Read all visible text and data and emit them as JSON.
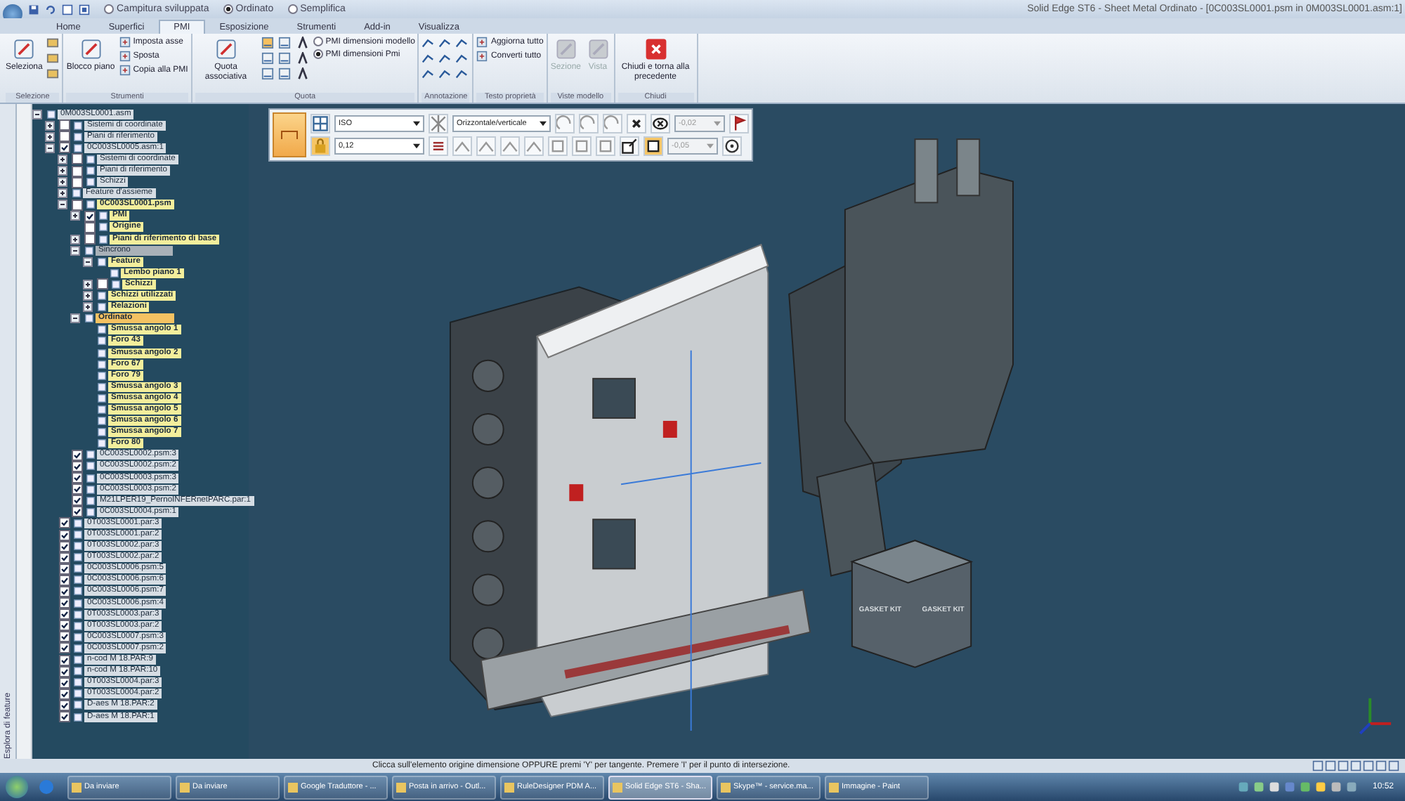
{
  "window": {
    "title": "Solid Edge ST6 - Sheet Metal Ordinato - [0C003SL0001.psm in 0M003SL0001.asm:1]"
  },
  "quick_access": [
    {
      "label": "Campitura sviluppata",
      "selected": false
    },
    {
      "label": "Ordinato",
      "selected": true
    },
    {
      "label": "Semplifica",
      "selected": false
    }
  ],
  "tabs": [
    {
      "label": "Home",
      "selected": false
    },
    {
      "label": "Superfici",
      "selected": false
    },
    {
      "label": "PMI",
      "selected": true
    },
    {
      "label": "Esposizione",
      "selected": false
    },
    {
      "label": "Strumenti",
      "selected": false
    },
    {
      "label": "Add-in",
      "selected": false
    },
    {
      "label": "Visualizza",
      "selected": false
    }
  ],
  "ribbon": [
    {
      "label": "Selezione",
      "items": [
        {
          "kind": "large",
          "label": "Seleziona",
          "disabled": false
        }
      ]
    },
    {
      "label": "Strumenti",
      "items": [
        {
          "kind": "large",
          "label": "Blocco piano",
          "disabled": false
        },
        {
          "kind": "small",
          "label": "Imposta asse",
          "disabled": false
        },
        {
          "kind": "small",
          "label": "Sposta",
          "disabled": false
        },
        {
          "kind": "small",
          "label": "Copia alla PMI",
          "disabled": false
        }
      ]
    },
    {
      "label": "Quota",
      "items": [
        {
          "kind": "large",
          "label": "Quota associativa",
          "disabled": false
        },
        {
          "kind": "radio",
          "label": "PMI dimensioni modello",
          "selected": false
        },
        {
          "kind": "radio",
          "label": "PMI dimensioni Pmi",
          "selected": true
        }
      ]
    },
    {
      "label": "Annotazione"
    },
    {
      "label": "Testo proprietà",
      "items": [
        {
          "kind": "small",
          "label": "Aggiorna tutto",
          "disabled": false
        },
        {
          "kind": "small",
          "label": "Converti tutto",
          "disabled": false
        }
      ]
    },
    {
      "label": "Viste modello",
      "items": [
        {
          "kind": "large",
          "label": "Sezione",
          "disabled": true
        },
        {
          "kind": "large",
          "label": "Vista",
          "disabled": true
        }
      ]
    },
    {
      "label": "Chiudi",
      "items": [
        {
          "kind": "close",
          "label": "Chiudi e torna alla precedente",
          "disabled": false
        }
      ]
    }
  ],
  "side_tab": {
    "label": "Esplora di feature"
  },
  "tree": [
    {
      "label": "0M003SL0001.asm",
      "selected": false,
      "active": false,
      "expanded": true,
      "children": [
        {
          "label": "Sistemi di coordinate",
          "selected": false,
          "active": false,
          "expanded": false,
          "checked": false
        },
        {
          "label": "Piani di riferimento",
          "selected": false,
          "active": false,
          "expanded": false,
          "checked": false
        },
        {
          "label": "0C003SL0005.asm:1",
          "selected": false,
          "active": false,
          "expanded": true,
          "checked": true,
          "children": [
            {
              "label": "Sistemi di coordinate",
              "selected": false,
              "active": false,
              "expanded": false,
              "checked": false
            },
            {
              "label": "Piani di riferimento",
              "selected": false,
              "active": false,
              "expanded": false,
              "checked": false
            },
            {
              "label": "Schizzi",
              "selected": false,
              "active": false,
              "expanded": false,
              "checked": false
            },
            {
              "label": "Feature d'assieme",
              "selected": false,
              "active": false,
              "expanded": false
            },
            {
              "label": "0C003SL0001.psm",
              "selected": false,
              "active": true,
              "expanded": true,
              "checked": false,
              "children": [
                {
                  "label": "PMI",
                  "selected": false,
                  "active": true,
                  "expanded": false,
                  "checked": true
                },
                {
                  "label": "Origine",
                  "selected": false,
                  "active": true,
                  "checked": false
                },
                {
                  "label": "Piani di riferimento di base",
                  "selected": false,
                  "active": true,
                  "expanded": false,
                  "checked": false
                },
                {
                  "label": "Sincrono",
                  "selected": true,
                  "active": false,
                  "expanded": true,
                  "children": [
                    {
                      "label": "Feature",
                      "selected": false,
                      "active": true,
                      "expanded": true,
                      "children": [
                        {
                          "label": "Lembo piano 1",
                          "selected": false,
                          "active": true
                        }
                      ]
                    },
                    {
                      "label": "Schizzi",
                      "selected": false,
                      "active": true,
                      "expanded": false,
                      "checked": false
                    },
                    {
                      "label": "Schizzi utilizzati",
                      "selected": false,
                      "active": true,
                      "expanded": false
                    },
                    {
                      "label": "Relazioni",
                      "selected": false,
                      "active": true,
                      "expanded": false
                    }
                  ]
                },
                {
                  "label": "Ordinato",
                  "selected": true,
                  "active": true,
                  "expanded": true,
                  "children": [
                    {
                      "label": "Smussa angolo 1",
                      "selected": false,
                      "active": true
                    },
                    {
                      "label": "Foro 43",
                      "selected": false,
                      "active": true
                    },
                    {
                      "label": "Smussa angolo 2",
                      "selected": false,
                      "active": true
                    },
                    {
                      "label": "Foro 67",
                      "selected": false,
                      "active": true
                    },
                    {
                      "label": "Foro 79",
                      "selected": false,
                      "active": true
                    },
                    {
                      "label": "Smussa angolo 3",
                      "selected": false,
                      "active": true
                    },
                    {
                      "label": "Smussa angolo 4",
                      "selected": false,
                      "active": true
                    },
                    {
                      "label": "Smussa angolo 5",
                      "selected": false,
                      "active": true
                    },
                    {
                      "label": "Smussa angolo 6",
                      "selected": false,
                      "active": true
                    },
                    {
                      "label": "Smussa angolo 7",
                      "selected": false,
                      "active": true
                    },
                    {
                      "label": "Foro 80",
                      "selected": false,
                      "active": true
                    }
                  ]
                }
              ]
            },
            {
              "label": "0C003SL0002.psm:3",
              "selected": false,
              "active": false,
              "checked": true
            },
            {
              "label": "0C003SL0002.psm:2",
              "selected": false,
              "active": false,
              "checked": true
            },
            {
              "label": "0C003SL0003.psm:3",
              "selected": false,
              "active": false,
              "checked": true
            },
            {
              "label": "0C003SL0003.psm:2",
              "selected": false,
              "active": false,
              "checked": true
            },
            {
              "label": "M21LPER19_PernoINFERnetPARC.par:1",
              "selected": false,
              "active": false,
              "checked": true
            },
            {
              "label": "0C003SL0004.psm:1",
              "selected": false,
              "active": false,
              "checked": true
            }
          ]
        },
        {
          "label": "0T003SL0001.par:3",
          "selected": false,
          "active": false,
          "checked": true
        },
        {
          "label": "0T003SL0001.par:2",
          "selected": false,
          "active": false,
          "checked": true
        },
        {
          "label": "0T003SL0002.par:3",
          "selected": false,
          "active": false,
          "checked": true
        },
        {
          "label": "0T003SL0002.par:2",
          "selected": false,
          "active": false,
          "checked": true
        },
        {
          "label": "0C003SL0006.psm:5",
          "selected": false,
          "active": false,
          "checked": true
        },
        {
          "label": "0C003SL0006.psm:6",
          "selected": false,
          "active": false,
          "checked": true
        },
        {
          "label": "0C003SL0006.psm:7",
          "selected": false,
          "active": false,
          "checked": true
        },
        {
          "label": "0C003SL0006.psm:4",
          "selected": false,
          "active": false,
          "checked": true
        },
        {
          "label": "0T003SL0003.par:3",
          "selected": false,
          "active": false,
          "checked": true
        },
        {
          "label": "0T003SL0003.par:2",
          "selected": false,
          "active": false,
          "checked": true
        },
        {
          "label": "0C003SL0007.psm:3",
          "selected": false,
          "active": false,
          "checked": true
        },
        {
          "label": "0C003SL0007.psm:2",
          "selected": false,
          "active": false,
          "checked": true
        },
        {
          "label": "n-cod M 18.PAR:9",
          "selected": false,
          "active": false,
          "checked": true
        },
        {
          "label": "n-cod M 18.PAR:10",
          "selected": false,
          "active": false,
          "checked": true
        },
        {
          "label": "0T003SL0004.par:3",
          "selected": false,
          "active": false,
          "checked": true
        },
        {
          "label": "0T003SL0004.par:2",
          "selected": false,
          "active": false,
          "checked": true
        },
        {
          "label": "D-aes M 18.PAR:2",
          "selected": false,
          "active": false,
          "checked": true
        },
        {
          "label": "D-aes M 18.PAR:1",
          "selected": false,
          "active": false,
          "checked": true
        }
      ]
    }
  ],
  "dimension_toolbar": {
    "standard": "ISO",
    "text_size": "0,12",
    "orientation": "Orizzontale/verticale",
    "upper_tolerance": "-0,02",
    "lower_tolerance": "-0,05"
  },
  "model": {
    "box_labels": [
      "GASKET KIT",
      "GASKET KIT"
    ]
  },
  "status_bar": {
    "prompt": "Clicca sull'elemento origine dimensione OPPURE premi 'Y' per tangente.  Premere 'I' per il punto di intersezione."
  },
  "taskbar": {
    "buttons": [
      {
        "label": "Da inviare",
        "selected": false
      },
      {
        "label": "Da inviare",
        "selected": false
      },
      {
        "label": "Google Traduttore - ...",
        "selected": false
      },
      {
        "label": "Posta in arrivo - Outl...",
        "selected": false
      },
      {
        "label": "RuleDesigner PDM A...",
        "selected": false
      },
      {
        "label": "Solid Edge ST6 - Sha...",
        "selected": true
      },
      {
        "label": "Skype™ - service.ma...",
        "selected": false
      },
      {
        "label": "Immagine - Paint",
        "selected": false
      }
    ],
    "clock": "10:52"
  }
}
